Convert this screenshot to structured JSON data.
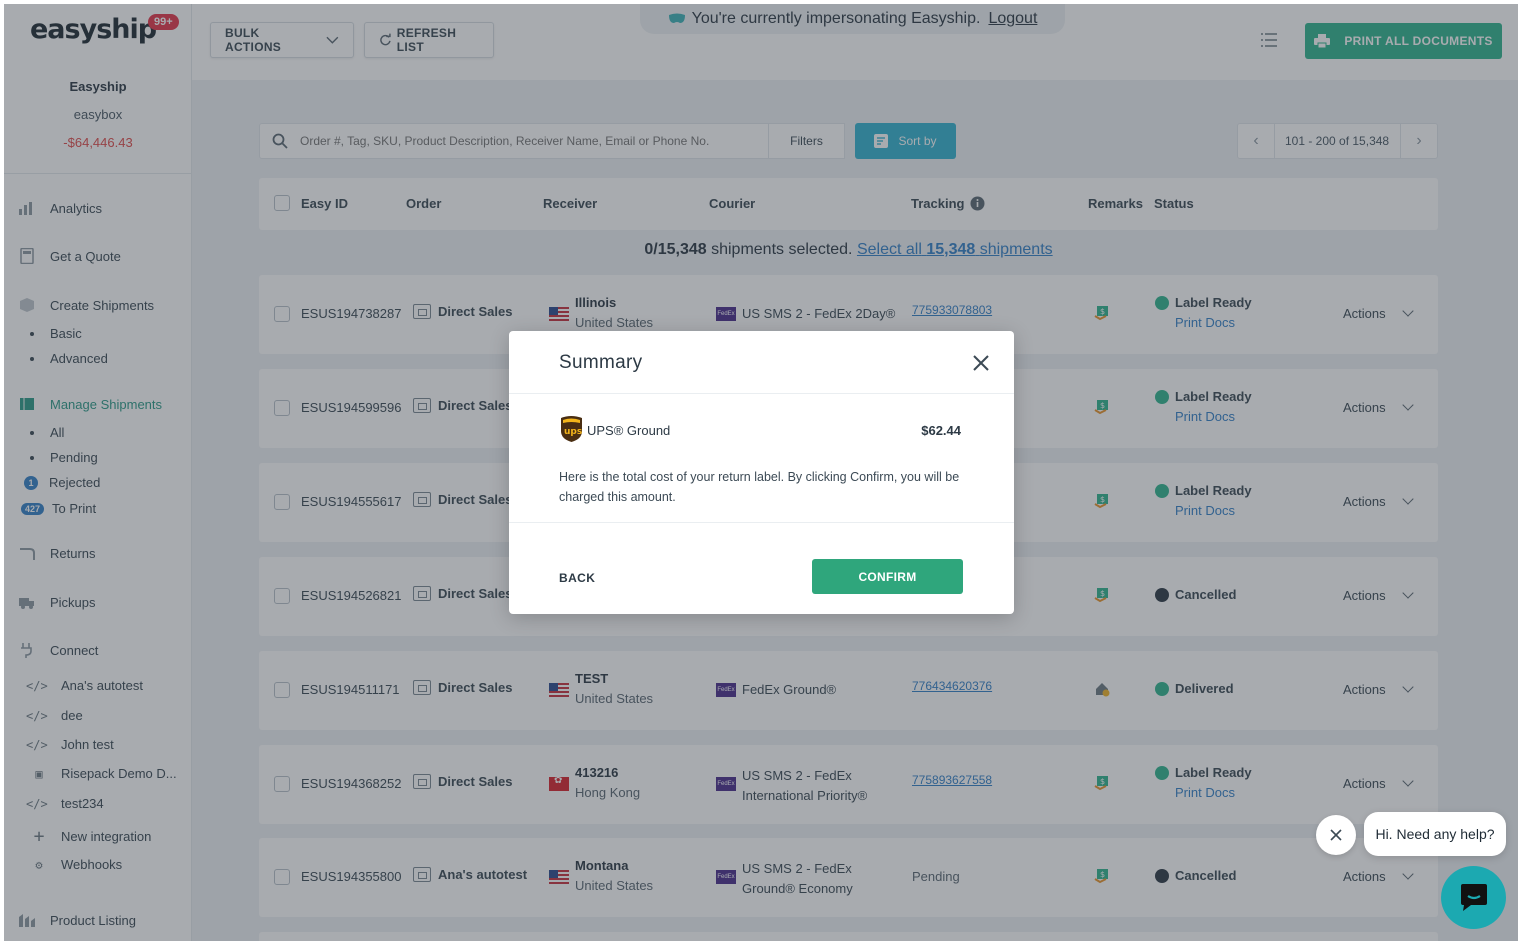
{
  "sidebar": {
    "logo": "easyship",
    "badge": "99+",
    "account_name": "Easyship",
    "account_sub": "easybox",
    "balance": "-$64,446.43",
    "nav": {
      "analytics": "Analytics",
      "quote": "Get a Quote",
      "create": "Create Shipments",
      "basic": "Basic",
      "advanced": "Advanced",
      "manage": "Manage Shipments",
      "all": "All",
      "pending": "Pending",
      "rejected_count": "1",
      "rejected": "Rejected",
      "toprint_count": "427",
      "toprint": "To Print",
      "returns": "Returns",
      "pickups": "Pickups",
      "connect": "Connect",
      "int1": "Ana's autotest",
      "int2": "dee",
      "int3": "John test",
      "int4": "Risepack Demo D...",
      "int5": "test234",
      "new_integration": "New integration",
      "webhooks": "Webhooks",
      "product_listing": "Product Listing"
    }
  },
  "topbar": {
    "bulk_actions": "BULK ACTIONS",
    "refresh": "REFRESH LIST",
    "impersonation": "You're currently impersonating Easyship.",
    "logout": "Logout",
    "print_all": "PRINT ALL DOCUMENTS"
  },
  "search": {
    "placeholder": "Order #, Tag, SKU, Product Description, Receiver Name, Email or Phone No.",
    "filters": "Filters",
    "sort_by": "Sort by",
    "pager": "101 - 200 of 15,348"
  },
  "table": {
    "headers": {
      "easy_id": "Easy ID",
      "order": "Order",
      "receiver": "Receiver",
      "courier": "Courier",
      "tracking": "Tracking",
      "remarks": "Remarks",
      "status": "Status"
    },
    "selection": {
      "count": "0/15,348",
      "text": "shipments selected.",
      "link_pre": "Select all",
      "link_num": "15,348",
      "link_post": "shipments"
    },
    "rows": [
      {
        "id": "ESUS194738287",
        "order": "Direct Sales",
        "receiver": "Illinois",
        "country": "United States",
        "courier": "US SMS 2 - FedEx 2Day®",
        "courier2": "",
        "tracking": "775933078803",
        "status": "Label Ready",
        "print": "Print Docs",
        "actions": "Actions"
      },
      {
        "id": "ESUS194599596",
        "order": "Direct Sales",
        "receiver": "",
        "country": "",
        "courier": "",
        "courier2": "",
        "tracking": "",
        "status": "Label Ready",
        "print": "Print Docs",
        "actions": "Actions"
      },
      {
        "id": "ESUS194555617",
        "order": "Direct Sales",
        "receiver": "",
        "country": "",
        "courier": "",
        "courier2": "",
        "tracking": "",
        "status": "Label Ready",
        "print": "Print Docs",
        "actions": "Actions"
      },
      {
        "id": "ESUS194526821",
        "order": "Direct Sales",
        "receiver": "",
        "country": "",
        "courier": "",
        "courier2": "",
        "tracking": "",
        "status": "Cancelled",
        "print": "",
        "actions": "Actions"
      },
      {
        "id": "ESUS194511171",
        "order": "Direct Sales",
        "receiver": "TEST",
        "country": "United States",
        "courier": "FedEx Ground®",
        "courier2": "",
        "tracking": "776434620376",
        "status": "Delivered",
        "print": "",
        "actions": "Actions"
      },
      {
        "id": "ESUS194368252",
        "order": "Direct Sales",
        "receiver": "413216",
        "country": "Hong Kong",
        "courier": "US SMS 2 - FedEx",
        "courier2": "International Priority®",
        "tracking": "775893627558",
        "status": "Label Ready",
        "print": "Print Docs",
        "actions": "Actions"
      },
      {
        "id": "ESUS194355800",
        "order": "Ana's autotest",
        "receiver": "Montana",
        "country": "United States",
        "courier": "US SMS 2 - FedEx",
        "courier2": "Ground® Economy",
        "tracking": "Pending",
        "status": "Cancelled",
        "print": "",
        "actions": "Actions"
      }
    ]
  },
  "modal": {
    "title": "Summary",
    "courier": "UPS® Ground",
    "price": "$62.44",
    "description": "Here is the total cost of your return label. By clicking Confirm, you will be charged this amount.",
    "back": "BACK",
    "confirm": "CONFIRM"
  },
  "chat": {
    "message": "Hi. Need any help?"
  },
  "colors": {
    "accent": "#31b590",
    "link": "#3581c9",
    "label_ready": "#31b590",
    "cancelled": "#2d3a45",
    "balance": "#e14c4c"
  }
}
